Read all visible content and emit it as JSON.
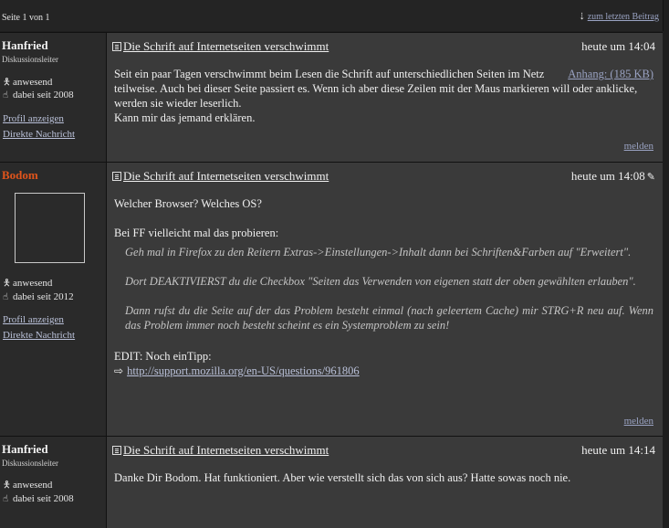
{
  "topbar": {
    "pager": "Seite 1 von 1",
    "last_post_link": "zum letzten Beitrag"
  },
  "posts": [
    {
      "username": "Hanfried",
      "rank": "Diskussionsleiter",
      "status": "anwesend",
      "since": "dabei seit 2008",
      "profile_link": "Profil anzeigen",
      "message_link": "Direkte Nachricht",
      "title": "Die Schrift auf Internetseiten verschwimmt",
      "time": "heute um 14:04",
      "attachment": "Anhang: (185 KB)",
      "body_1": "Seit ein paar Tagen verschwimmt beim Lesen die Schrift auf unterschiedlichen Seiten im Netz",
      "body_2": "teilweise. Auch bei dieser Seite passiert es. Wenn ich aber diese Zeilen mit der Maus markieren will oder anklicke, werden sie wieder leserlich.",
      "body_3": "Kann mir das jemand erklären.",
      "report": "melden"
    },
    {
      "username": "Bodom",
      "status": "anwesend",
      "since": "dabei seit 2012",
      "profile_link": "Profil anzeigen",
      "message_link": "Direkte Nachricht",
      "title": "Die Schrift auf Internetseiten verschwimmt",
      "time": "heute um 14:08",
      "line_1": "Welcher Browser? Welches OS?",
      "line_2": "Bei FF vielleicht mal das probieren:",
      "quote_1": "Geh mal in Firefox zu den Reitern Extras->Einstellungen->Inhalt dann bei Schriften&Farben auf \"Erweitert\".",
      "quote_2": "Dort DEAKTIVIERST du die Checkbox \"Seiten das Verwenden von eigenen statt der oben gewählten erlauben\".",
      "quote_3": "Dann rufst du die Seite auf der das Problem besteht einmal (nach geleertem Cache) mir STRG+R neu auf. Wenn das Problem immer noch besteht scheint es ein Systemproblem zu sein!",
      "edit_line": "EDIT: Noch einTipp:",
      "link": "http://support.mozilla.org/en-US/questions/961806",
      "report": "melden"
    },
    {
      "username": "Hanfried",
      "rank": "Diskussionsleiter",
      "status": "anwesend",
      "since": "dabei seit 2008",
      "title": "Die Schrift auf Internetseiten verschwimmt",
      "time": "heute um 14:14",
      "body_1": "Danke Dir Bodom. Hat funktioniert. Aber wie verstellt sich das von sich aus? Hatte sowas noch nie."
    }
  ],
  "colors": {
    "page_bg": "#1e1e1e",
    "post_bg": "#3a3a3a",
    "sidebar_bg": "#2a2a2a",
    "link": "#9aa3c3",
    "username_highlight": "#e0541b"
  },
  "icons": {
    "down_arrow": "down-arrow-icon",
    "document": "document-icon",
    "person": "person-icon",
    "hand": "hand-icon",
    "edit": "edit-icon",
    "external_link": "external-link-icon"
  }
}
